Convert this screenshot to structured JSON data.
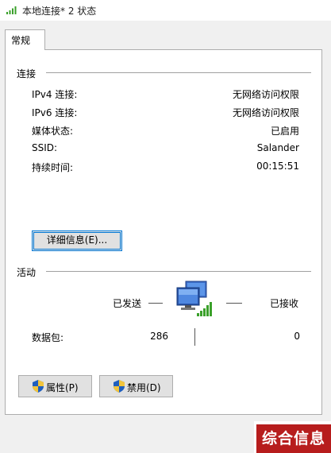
{
  "window": {
    "title": "本地连接* 2 状态"
  },
  "tabs": [
    {
      "label": "常规"
    }
  ],
  "connection": {
    "label": "连接",
    "rows": [
      {
        "label": "IPv4 连接:",
        "value": "无网络访问权限"
      },
      {
        "label": "IPv6 连接:",
        "value": "无网络访问权限"
      },
      {
        "label": "媒体状态:",
        "value": "已启用"
      },
      {
        "label": "SSID:",
        "value": "Salander"
      },
      {
        "label": "持续时间:",
        "value": "00:15:51"
      }
    ],
    "details_button": "详细信息(E)..."
  },
  "activity": {
    "label": "活动",
    "sent_label": "已发送",
    "received_label": "已接收",
    "packets_label": "数据包:",
    "packets_sent": "286",
    "packets_received": "0"
  },
  "buttons": {
    "properties": "属性(P)",
    "disable": "禁用(D)"
  },
  "watermark": "综合信息",
  "icons": {
    "title": "wifi-signal-icon",
    "network": "network-computer-icon",
    "shield": "uac-shield-icon"
  },
  "colors": {
    "accent": "#0078d7",
    "signal_green": "#3aa02a",
    "watermark_bg": "#b71d1d"
  }
}
